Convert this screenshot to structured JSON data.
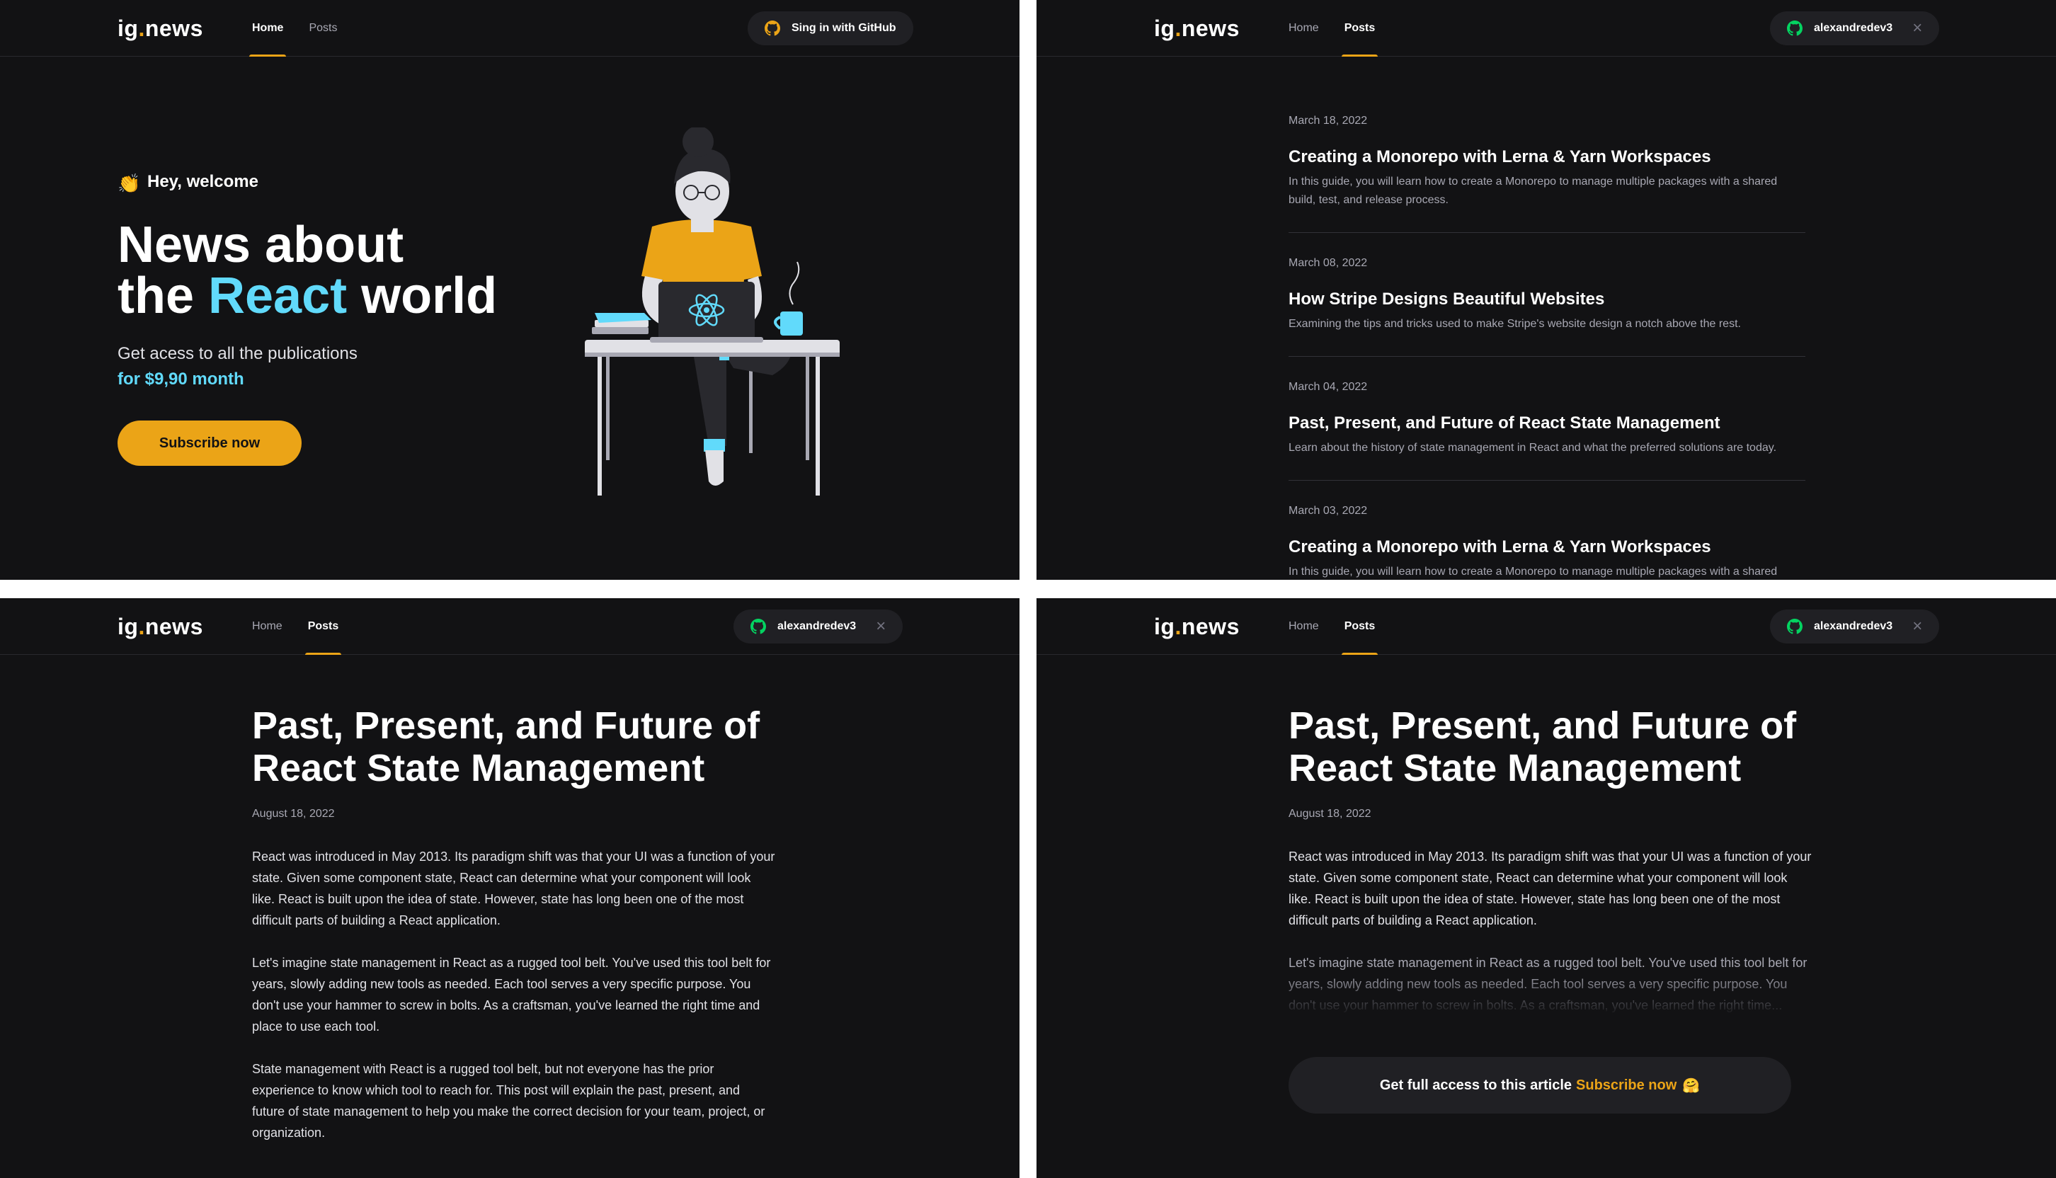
{
  "app": {
    "logo_main": "ig",
    "logo_dot": ".",
    "logo_tld": "news"
  },
  "nav": {
    "home": "Home",
    "posts": "Posts"
  },
  "colors": {
    "background": "#121214",
    "accent": "#eba417",
    "react": "#61dafb",
    "panel_bg": "#202024",
    "github_green": "#04d361"
  },
  "panels": {
    "home": {
      "signin_label": "Sing in with GitHub",
      "greeting_emoji": "👏",
      "greeting": "Hey, welcome",
      "title_line1": "News about",
      "title_the": "the ",
      "title_react": "React",
      "title_world": " world",
      "subtitle": "Get acess to all the publications",
      "price": "for $9,90 month",
      "subscribe_label": "Subscribe now",
      "illustration": "woman-at-laptop-illustration"
    },
    "user": {
      "username": "alexandredev3",
      "close_icon": "×"
    },
    "posts": [
      {
        "date": "March 18, 2022",
        "title": "Creating a Monorepo with Lerna & Yarn Workspaces",
        "excerpt": "In this guide, you will learn how to create a Monorepo to manage multiple packages with a shared build, test, and release process."
      },
      {
        "date": "March 08, 2022",
        "title": "How Stripe Designs Beautiful Websites",
        "excerpt": "Examining the tips and tricks used to make Stripe's website design a notch above the rest."
      },
      {
        "date": "March 04, 2022",
        "title": "Past, Present, and Future of React State Management",
        "excerpt": "Learn about the history of state management in React and what the preferred solutions are today."
      },
      {
        "date": "March 03, 2022",
        "title": "Creating a Monorepo with Lerna & Yarn Workspaces",
        "excerpt": "In this guide, you will learn how to create a Monorepo to manage multiple packages with a shared build, test, and release process."
      }
    ],
    "article": {
      "title": "Past, Present, and Future of React State Management",
      "date": "August 18, 2022",
      "paragraphs": [
        "React was introduced in May 2013. Its paradigm shift was that your UI was a function of your state. Given some component state, React can determine what your component will look like. React is built upon the idea of state. However, state has long been one of the most difficult parts of building a React application.",
        "Let's imagine state management in React as a rugged tool belt. You've used this tool belt for years, slowly adding new tools as needed. Each tool serves a very specific purpose. You don't use your hammer to screw in bolts. As a craftsman, you've learned the right time and place to use each tool.",
        "State management with React is a rugged tool belt, but not everyone has the prior experience to know which tool to reach for. This post will explain the past, present, and future of state management to help you make the correct decision for your team, project, or organization."
      ],
      "preview_paragraph2": "Let's imagine state management in React as a rugged tool belt. You've used this tool belt for years, slowly adding new tools as needed. Each tool serves a very specific purpose. You don't use your hammer to screw in bolts. As a craftsman, you've learned the right time...",
      "cta_text": "Get full access to this article",
      "cta_link": "Subscribe now",
      "cta_emoji": "🤗"
    }
  }
}
